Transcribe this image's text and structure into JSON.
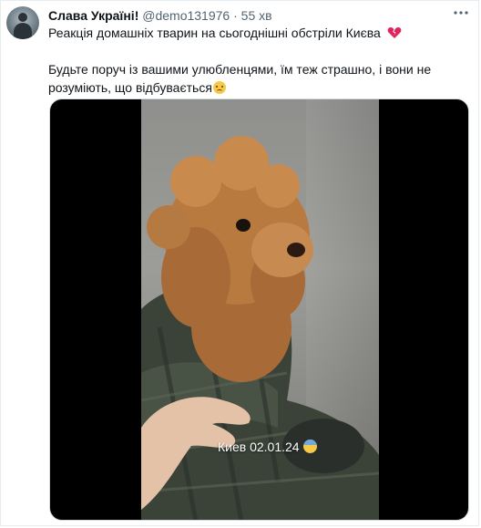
{
  "tweet": {
    "display_name": "Слава Україні!",
    "handle": "@demo131976",
    "separator": "·",
    "time": "55 хв",
    "more_icon": "more-dots-icon",
    "line1": "Реакція домашніх тварин на сьогоднішні обстріли Києва",
    "line1_emoji": "broken-heart-icon",
    "line2": "Будьте поруч із вашими улюбленцями, їм теж страшно, і вони не розуміють, що відбувається",
    "line2_emoji": "crying-face-icon"
  },
  "media": {
    "caption": "Киев 02.01.24",
    "caption_emoji": "anxious-face-icon"
  },
  "colors": {
    "text": "#0f1419",
    "secondary": "#536471",
    "heart": "#e0245e"
  }
}
